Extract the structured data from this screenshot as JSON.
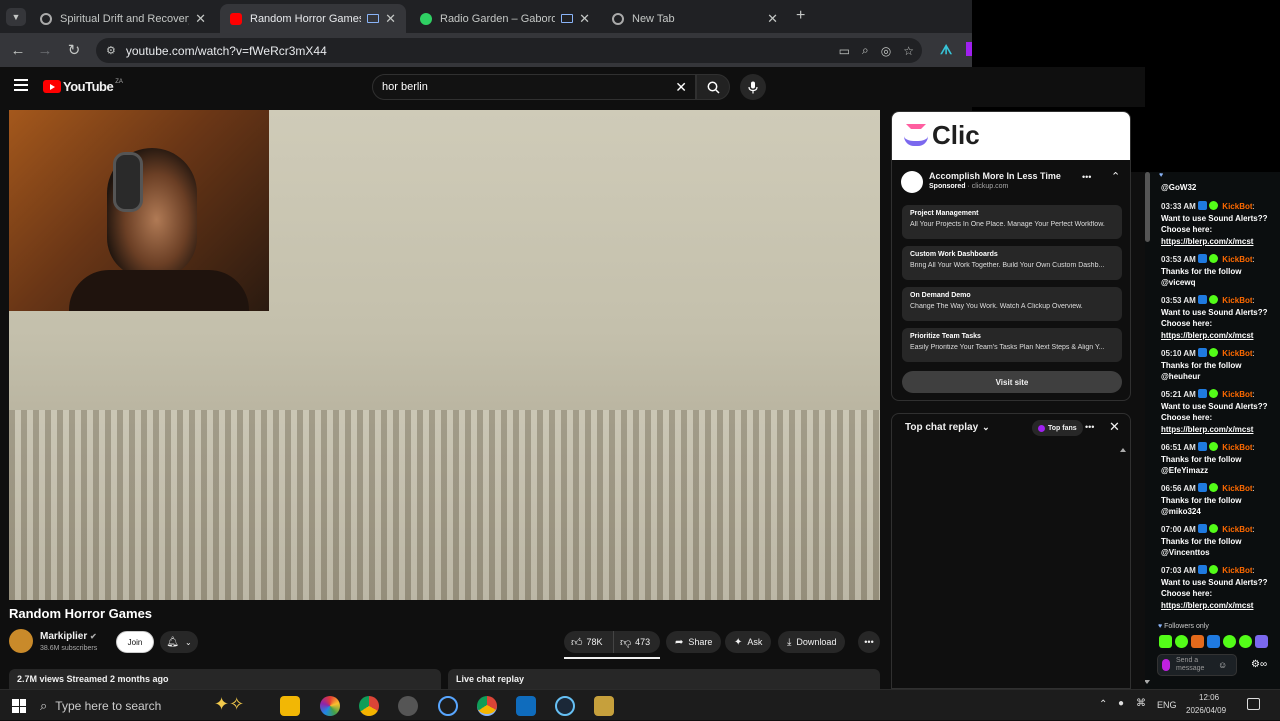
{
  "browser": {
    "tabs": [
      {
        "label": "Spiritual Drift and Recovery",
        "active": false
      },
      {
        "label": "Random Horror Games - Yo",
        "active": true
      },
      {
        "label": "Radio Garden – Gaborone",
        "active": false
      },
      {
        "label": "New Tab",
        "active": false
      }
    ],
    "new_tab_symbol": "+",
    "close_symbol": "✕",
    "url": "youtube.com/watch?v=fWeRcr3mX44"
  },
  "youtube": {
    "logo_text": "YouTube",
    "region": "ZA",
    "search_value": "hor berlin",
    "video_title": "Random Horror Games",
    "channel": {
      "name": "Markiplier",
      "subscribers": "38.6M subscribers"
    },
    "join_label": "Join",
    "likes": "78K",
    "dislikes": "473",
    "share_label": "Share",
    "ask_label": "Ask",
    "download_label": "Download",
    "desc_meta": "2.7M views  Streamed 2 months ago",
    "live_chat_replay": "Live chat replay",
    "ad": {
      "title": "Accomplish More In Less Time",
      "sponsored": "Sponsored",
      "domain": "clickup.com",
      "banner_text": "Clic",
      "items": [
        {
          "heading": "Project Management",
          "desc": "All Your Projects In One Place. Manage Your Perfect Workflow."
        },
        {
          "heading": "Custom Work Dashboards",
          "desc": "Bring All Your Work Together. Build Your Own Custom Dashb..."
        },
        {
          "heading": "On Demand Demo",
          "desc": "Change The Way You Work. Watch A Clickup Overview."
        },
        {
          "heading": "Prioritize Team Tasks",
          "desc": "Easily Prioritize Your Team's Tasks Plan Next Steps & Align Y..."
        }
      ],
      "visit_label": "Visit site"
    },
    "chat": {
      "title": "Top chat replay",
      "top_fans": "Top fans"
    }
  },
  "kick": {
    "first_user": "@GoW32",
    "messages": [
      {
        "time": "03:33 AM",
        "bot": "KickBot",
        "text": "Want to use Sound Alerts?? Choose here:",
        "link": "https://blerp.com/x/mcst"
      },
      {
        "time": "03:53 AM",
        "bot": "KickBot",
        "text": "Thanks for the follow",
        "user": "@vicewq"
      },
      {
        "time": "03:53 AM",
        "bot": "KickBot",
        "text": "Want to use Sound Alerts?? Choose here:",
        "link": "https://blerp.com/x/mcst"
      },
      {
        "time": "05:10 AM",
        "bot": "KickBot",
        "text": "Thanks for the follow",
        "user": "@heuheur"
      },
      {
        "time": "05:21 AM",
        "bot": "KickBot",
        "text": "Want to use Sound Alerts?? Choose here:",
        "link": "https://blerp.com/x/mcst"
      },
      {
        "time": "06:51 AM",
        "bot": "KickBot",
        "text": "Thanks for the follow",
        "user": "@EfeYimazz"
      },
      {
        "time": "06:56 AM",
        "bot": "KickBot",
        "text": "Thanks for the follow",
        "user": "@miko324"
      },
      {
        "time": "07:00 AM",
        "bot": "KickBot",
        "text": "Thanks for the follow",
        "user": "@Vincenttos"
      },
      {
        "time": "07:03 AM",
        "bot": "KickBot",
        "text": "Want to use Sound Alerts?? Choose here:",
        "link": "https://blerp.com/x/mcst"
      }
    ],
    "followers_only": "Followers only",
    "send_placeholder": "Send a message"
  },
  "taskbar": {
    "search_placeholder": "Type here to search",
    "lang": "ENG",
    "time": "12:06",
    "date": "2026/04/09"
  },
  "colors": {
    "accent_red": "#ff0000",
    "kick_green": "#53fc18",
    "kickbot_orange": "#ff6a00"
  }
}
